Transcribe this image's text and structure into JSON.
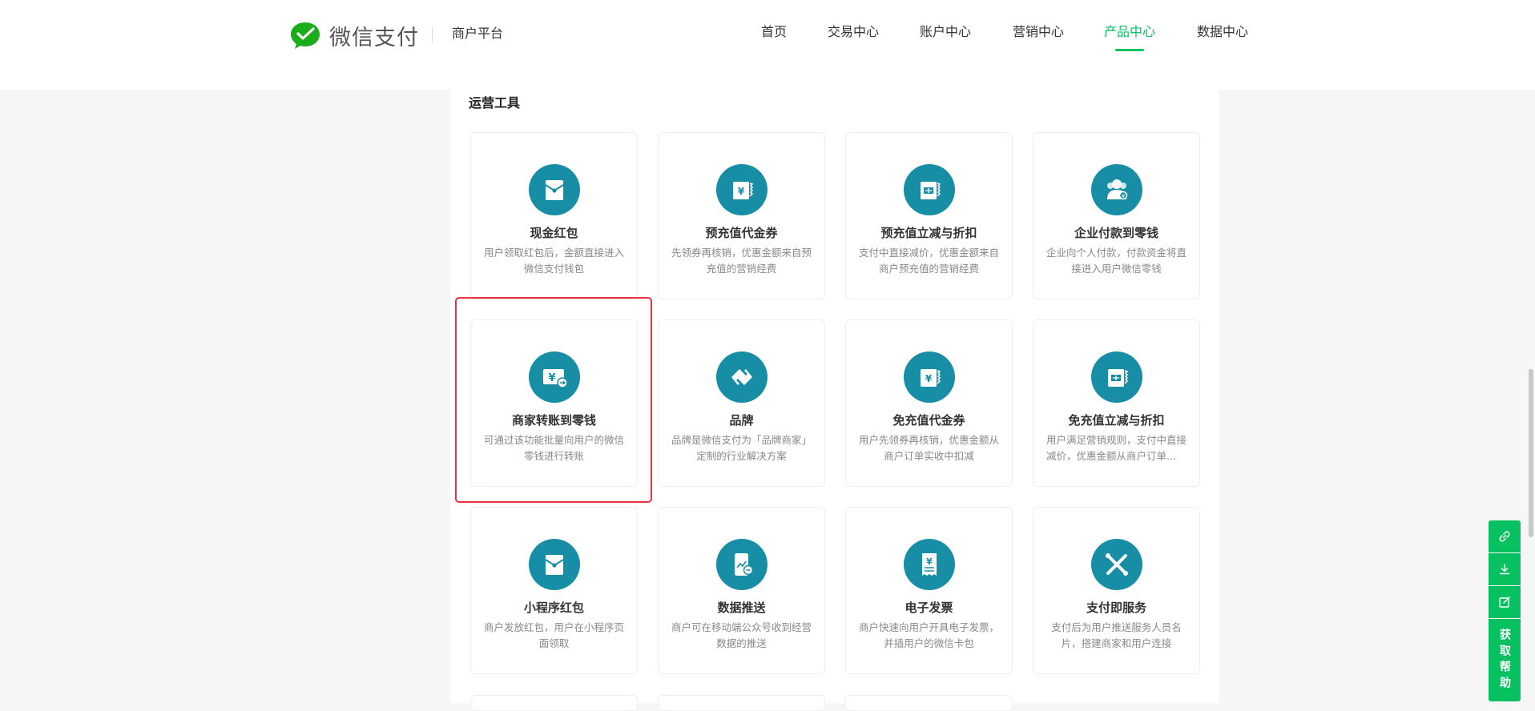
{
  "header": {
    "logo_text": "微信支付",
    "platform": "商户平台",
    "nav": [
      {
        "label": "首页"
      },
      {
        "label": "交易中心"
      },
      {
        "label": "账户中心"
      },
      {
        "label": "营销中心"
      },
      {
        "label": "产品中心",
        "active": true
      },
      {
        "label": "数据中心"
      }
    ]
  },
  "section": {
    "title": "运营工具"
  },
  "cards": [
    {
      "icon": "red-packet-icon",
      "title": "现金红包",
      "desc": "用户领取红包后，金额直接进入微信支付钱包"
    },
    {
      "icon": "yuan-coupon-icon",
      "title": "预充值代金券",
      "desc": "先领券再核销，优惠金额来自预充值的营销经费"
    },
    {
      "icon": "discount-coupon-icon",
      "title": "预充值立减与折扣",
      "desc": "支付中直接减价，优惠金额来自商户预充值的营销经费"
    },
    {
      "icon": "enterprise-payment-icon",
      "title": "企业付款到零钱",
      "desc": "企业向个人付款，付款资金将直接进入用户微信零钱"
    },
    {
      "icon": "merchant-transfer-icon",
      "title": "商家转账到零钱",
      "desc": "可通过该功能批量向用户的微信零钱进行转账"
    },
    {
      "icon": "brand-icon",
      "title": "品牌",
      "desc": "品牌是微信支付为「品牌商家」定制的行业解决方案"
    },
    {
      "icon": "yuan-coupon-icon",
      "title": "免充值代金券",
      "desc": "用户先领券再核销，优惠金额从商户订单实收中扣减"
    },
    {
      "icon": "discount-coupon-icon",
      "title": "免充值立减与折扣",
      "desc": "用户满足营销规则，支付中直接减价，优惠金额从商户订单实收中扣减"
    },
    {
      "icon": "red-packet-icon",
      "title": "小程序红包",
      "desc": "商户发放红包，用户在小程序页面领取"
    },
    {
      "icon": "data-push-icon",
      "title": "数据推送",
      "desc": "商户可在移动端公众号收到经营数据的推送"
    },
    {
      "icon": "invoice-icon",
      "title": "电子发票",
      "desc": "商户快速向用户开具电子发票，并插用户的微信卡包"
    },
    {
      "icon": "service-icon",
      "title": "支付即服务",
      "desc": "支付后为用户推送服务人员名片，搭建商家和用户连接"
    }
  ],
  "float_bar": {
    "help_label": "获取帮助"
  },
  "colors": {
    "accent": "#07c160",
    "icon_bg": "#178ea6",
    "highlight": "#e5343f"
  }
}
